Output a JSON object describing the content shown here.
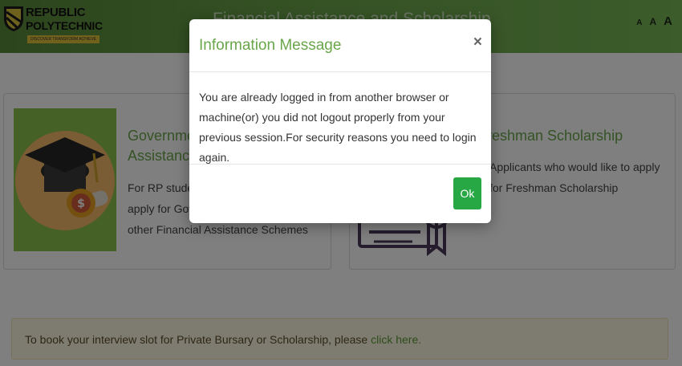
{
  "header": {
    "brand_line1": "REPUBLIC",
    "brand_line2": "POLYTECHNIC",
    "tagline": "DISCOVER TRANSFORM ACHIEVE",
    "title": "Financial Assistance and Scholarship",
    "font_sizes": [
      "A",
      "A",
      "A"
    ]
  },
  "cards": [
    {
      "title": "Government Financial Assistance",
      "description": "For RP students who would like to apply for Government Bursaries and other Financial Assistance Schemes",
      "image_icon": "graduation-cap-coin-icon"
    },
    {
      "title": "Freshman Scholarship",
      "description": "Applicants who would like to apply for Freshman Scholarship",
      "image_icon": "certificate-ribbon-icon"
    }
  ],
  "banner": {
    "text": "To book your interview slot for Private Bursary or Scholarship, please ",
    "link": "click here."
  },
  "modal": {
    "title": "Information Message",
    "close": "×",
    "body": "You are already logged in from another browser or machine(or) you did not logout properly from your previous session.For security reasons you need to login again.",
    "ok_label": "Ok"
  },
  "colors": {
    "header_green": "#6aa54a",
    "accent_green": "#6aa64a",
    "ok_button": "#28a745",
    "banner_bg": "#fcf8e3"
  }
}
